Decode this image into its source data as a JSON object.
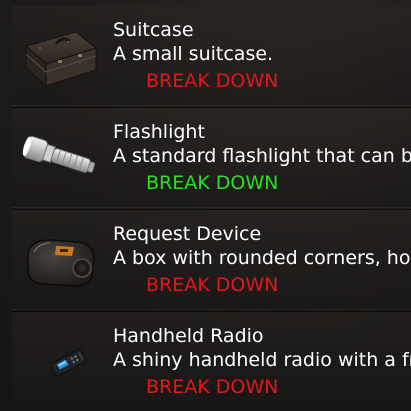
{
  "items": [
    {
      "name": "Suitcase",
      "description": "A small suitcase.",
      "action": "BREAK DOWN",
      "action_color": "red",
      "icon": "suitcase-icon"
    },
    {
      "name": "Flashlight",
      "description": "A standard flashlight that can be",
      "action": "BREAK DOWN",
      "action_color": "green",
      "icon": "flashlight-icon"
    },
    {
      "name": "Request Device",
      "description": "A box with rounded corners, hou",
      "action": "BREAK DOWN",
      "action_color": "red",
      "icon": "request-device-icon"
    },
    {
      "name": "Handheld Radio",
      "description": "A shiny handheld radio with a fre",
      "action": "BREAK DOWN",
      "action_color": "red",
      "icon": "handheld-radio-icon"
    }
  ],
  "colors": {
    "red": "#e3161a",
    "green": "#27e31a",
    "text": "#ffffff"
  }
}
